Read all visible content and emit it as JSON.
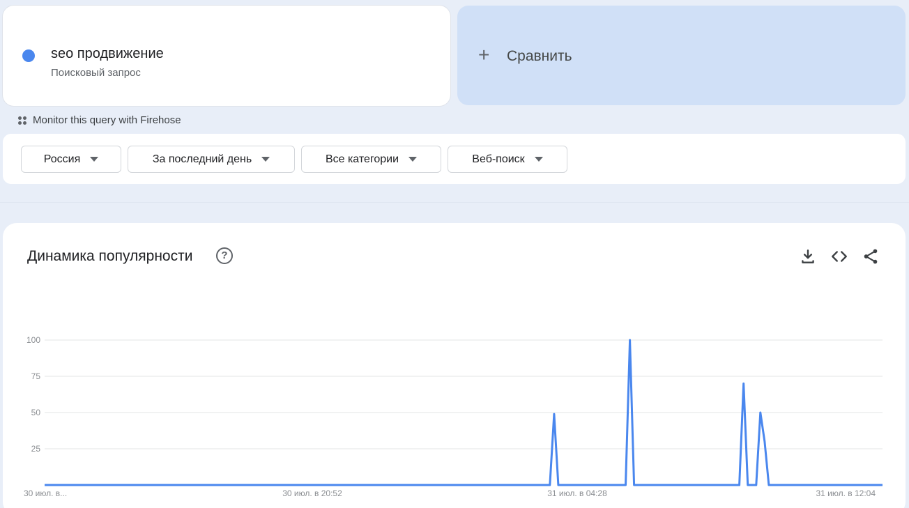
{
  "search_term": {
    "title": "seo продвижение",
    "subtitle": "Поисковый запрос",
    "color": "#4a87ee"
  },
  "compare": {
    "label": "Сравнить",
    "icon": "plus-icon"
  },
  "firehose": {
    "label": "Monitor this query with Firehose",
    "icon": "firehose-icon"
  },
  "filters": [
    {
      "label": "Россия"
    },
    {
      "label": "За последний день"
    },
    {
      "label": "Все категории"
    },
    {
      "label": "Веб-поиск"
    }
  ],
  "chart_section": {
    "title": "Динамика популярности",
    "help_icon": "help-icon",
    "actions": [
      "download-icon",
      "embed-icon",
      "share-icon"
    ]
  },
  "chart_data": {
    "type": "line",
    "ylim": [
      0,
      100
    ],
    "yticks": [
      25,
      50,
      75,
      100
    ],
    "xtick_labels": [
      "30 июл. в...",
      "30 июл. в 20:52",
      "31 июл. в 04:28",
      "31 июл. в 12:04"
    ],
    "grid": true,
    "series": [
      {
        "color": "#4a87ee",
        "points": [
          [
            0,
            0
          ],
          [
            120,
            0
          ],
          [
            121,
            49
          ],
          [
            122,
            0
          ],
          [
            138,
            0
          ],
          [
            139,
            100
          ],
          [
            140,
            0
          ],
          [
            165,
            0
          ],
          [
            166,
            70
          ],
          [
            167,
            0
          ],
          [
            169,
            0
          ],
          [
            170,
            50
          ],
          [
            171,
            30
          ],
          [
            172,
            0
          ],
          [
            199,
            0
          ]
        ]
      }
    ]
  }
}
